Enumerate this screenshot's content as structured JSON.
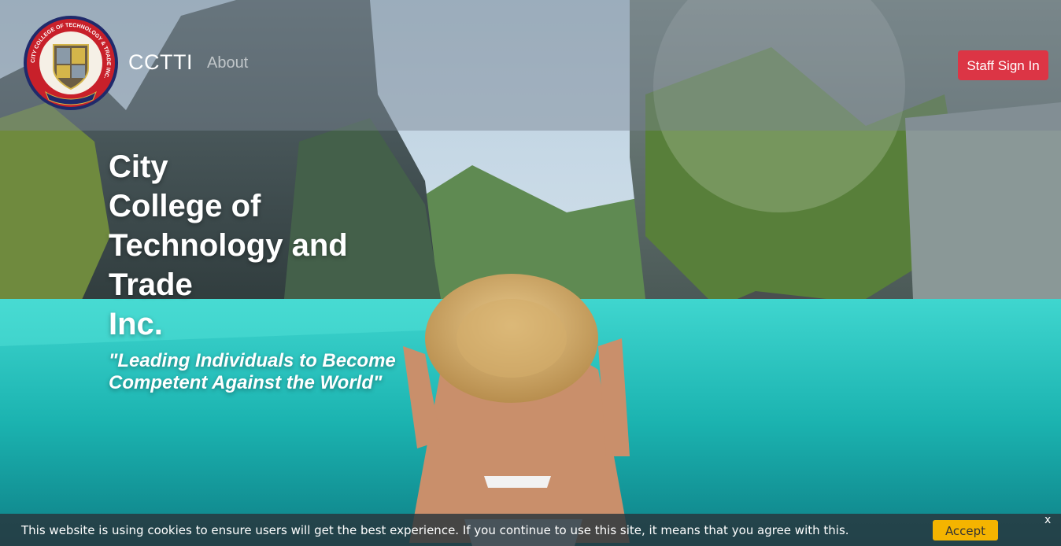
{
  "navbar": {
    "brand": "CCTTI",
    "about_label": "About",
    "staff_sign_in_label": "Staff Sign In",
    "logo_ring_text": "CITY COLLEGE OF TECHNOLOGY & TRADE INC."
  },
  "hero": {
    "title_lines": [
      "City",
      "College of",
      "Technology and",
      "Trade",
      "Inc."
    ],
    "tagline": "\"Leading Individuals to Become Competent Against the World\""
  },
  "cookie_banner": {
    "message": "This website is using cookies to ensure users will get the best experience. If you continue to use this site, it means that you agree with this.",
    "accept_label": "Accept",
    "close_label": "x"
  },
  "colors": {
    "staff_button": "#dc3545",
    "accept_button": "#f4b400",
    "logo_red": "#c8202a",
    "logo_navy": "#1f2a6b"
  }
}
